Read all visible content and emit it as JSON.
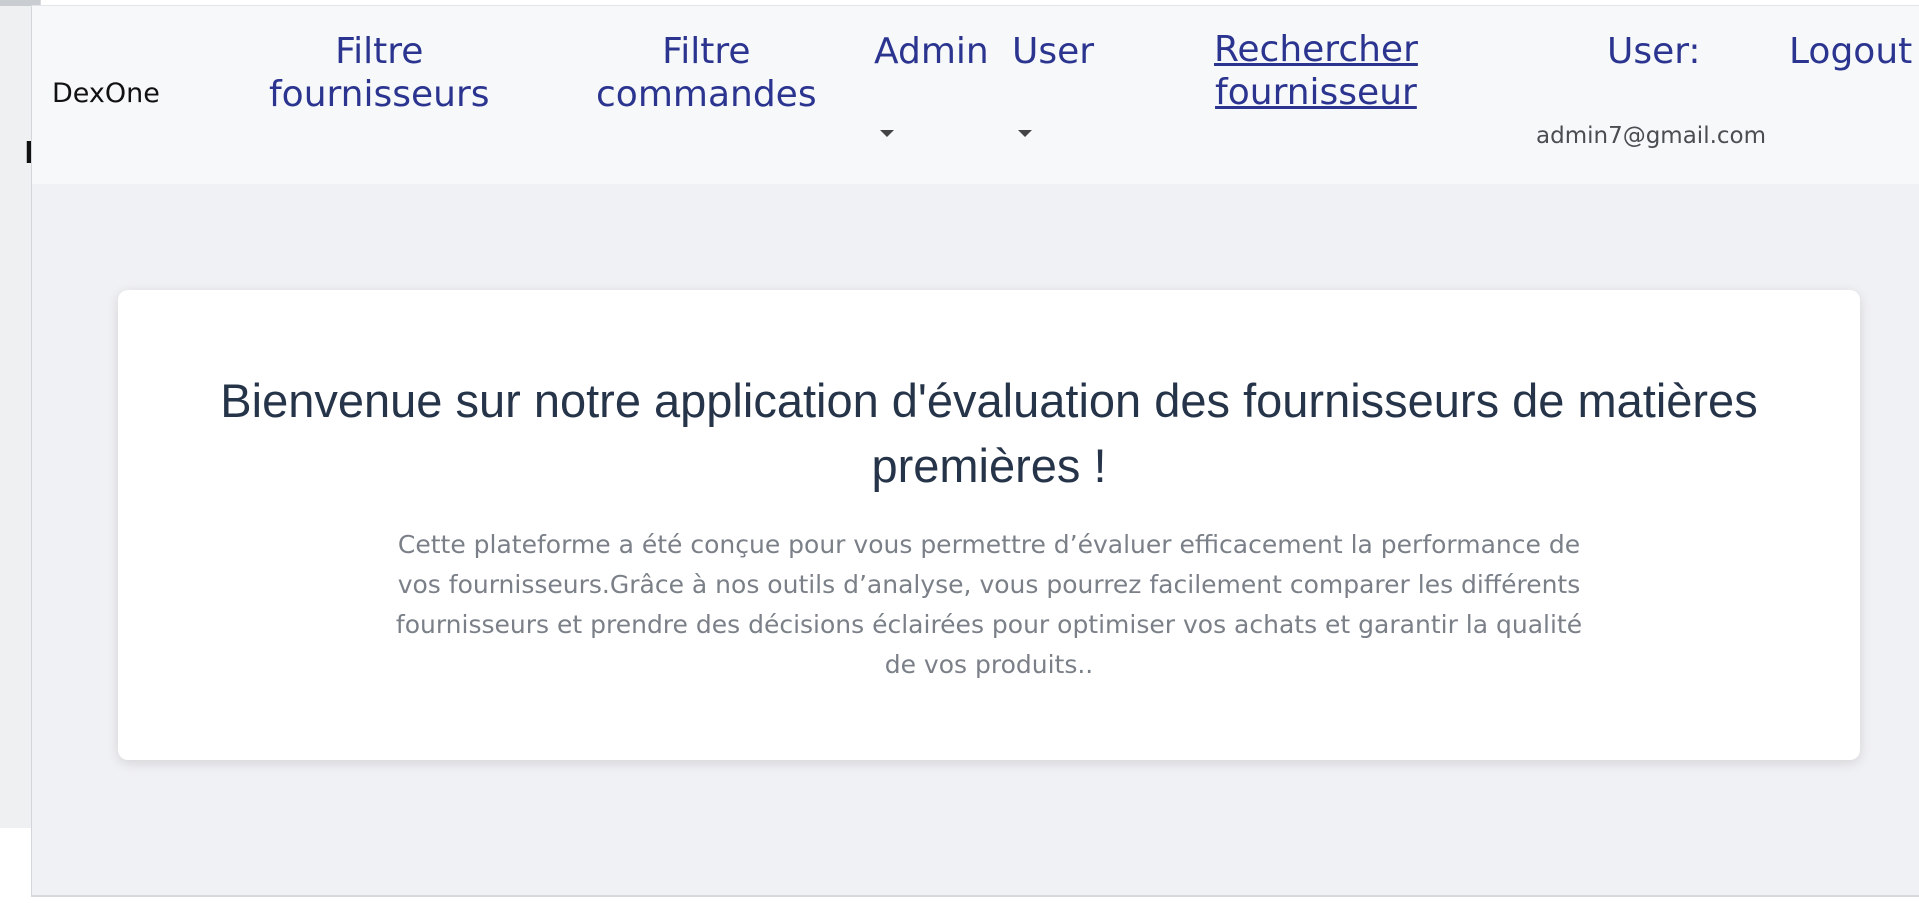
{
  "backdrop": {
    "peek_char": "D"
  },
  "navbar": {
    "brand": "DexOne",
    "links": {
      "filtre_fournisseurs": "Filtre\nfournisseurs",
      "filtre_commandes": "Filtre\ncommandes",
      "admin": "Admin",
      "user_menu": "User",
      "rechercher_fournisseur": "Rechercher\nfournisseur",
      "user_label": "User:",
      "logout": "Logout"
    },
    "user_email": "admin7@gmail.com"
  },
  "hero": {
    "title": "Bienvenue sur notre application d'évaluation des fournisseurs de matières premières !",
    "text": "Cette plateforme a été conçue pour vous permettre d’évaluer efficacement la performance de vos fournisseurs.Grâce à nos outils d’analyse, vous pourrez facilement comparer les différents fournisseurs et prendre des décisions éclairées pour optimiser vos achats et garantir la qualité de vos produits.."
  },
  "icons": {
    "admin_caret": "chevron-down-icon",
    "user_caret": "chevron-down-icon"
  },
  "colors": {
    "nav_link": "#2b3590",
    "title": "#263449",
    "body_text": "#7b8088",
    "page_bg": "#f0f1f4"
  }
}
